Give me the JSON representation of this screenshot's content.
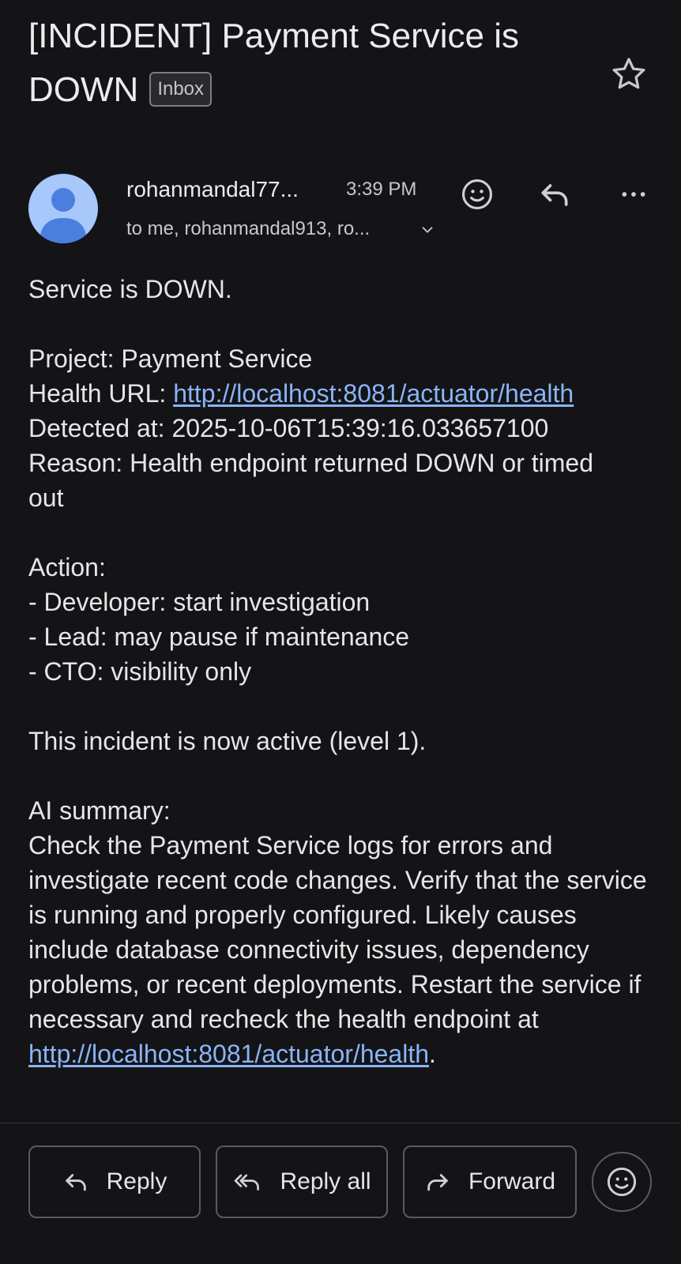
{
  "email": {
    "subject": "[INCIDENT] Payment Service is DOWN",
    "label": "Inbox",
    "sender": "rohanmandal77...",
    "time": "3:39 PM",
    "recipients": "to me, rohanmandal913, ro...",
    "body": {
      "line1": "Service is DOWN.",
      "project": "Project: Payment Service",
      "health_prefix": "Health URL: ",
      "health_url": "http://localhost:8081/actuator/health",
      "detected": "Detected at: 2025-10-06T15:39:16.033657100",
      "reason": "Reason: Health endpoint returned DOWN or timed out",
      "action_title": "Action:",
      "actions": [
        "- Developer: start investigation",
        "- Lead: may pause if maintenance",
        "- CTO: visibility only"
      ],
      "active": "This incident is now active (level 1).",
      "ai_title": "AI summary:",
      "ai_summary": "Check the Payment Service logs for errors and investigate recent code changes. Verify that the service is running and properly configured. Likely causes include database connectivity issues, dependency problems, or recent deployments. Restart the service if necessary and recheck the health endpoint at ",
      "ai_link": "http://localhost:8081/actuator/health",
      "ai_end": "."
    }
  },
  "actions_bar": {
    "reply": "Reply",
    "reply_all": "Reply all",
    "forward": "Forward"
  },
  "icons": {
    "star": "star-icon",
    "emoji": "emoji-icon",
    "reply": "reply-icon",
    "more": "more-icon",
    "reply_all": "reply-all-icon",
    "forward": "forward-icon"
  },
  "colors": {
    "background": "#141417",
    "link": "#8ab4f8",
    "avatar": "#a8c7fa",
    "avatar_figure": "#4a7fe0"
  }
}
